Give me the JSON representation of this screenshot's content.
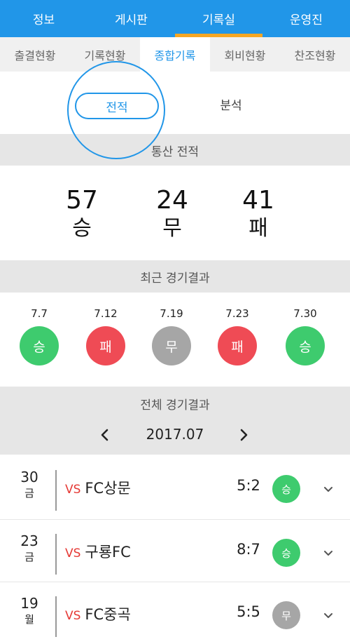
{
  "top_nav": {
    "tabs": [
      "정보",
      "게시판",
      "기록실",
      "운영진"
    ],
    "active": 2
  },
  "sub_nav": {
    "tabs": [
      "출결현황",
      "기록현황",
      "종합기록",
      "회비현황",
      "찬조현황"
    ],
    "active": 2
  },
  "segment": {
    "active": "전적",
    "other": "분석"
  },
  "record": {
    "header": "통산 전적",
    "win": {
      "value": "57",
      "label": "승"
    },
    "draw": {
      "value": "24",
      "label": "무"
    },
    "loss": {
      "value": "41",
      "label": "패"
    }
  },
  "recent": {
    "header": "최근 경기결과",
    "items": [
      {
        "date": "7.7",
        "result": "승"
      },
      {
        "date": "7.12",
        "result": "패"
      },
      {
        "date": "7.19",
        "result": "무"
      },
      {
        "date": "7.23",
        "result": "패"
      },
      {
        "date": "7.30",
        "result": "승"
      }
    ]
  },
  "all_results": {
    "header": "전체 경기결과",
    "month": "2017.07",
    "games": [
      {
        "day": "30",
        "weekday": "금",
        "vs": "VS",
        "opponent": "FC상문",
        "score": "5:2",
        "result": "승"
      },
      {
        "day": "23",
        "weekday": "금",
        "vs": "VS",
        "opponent": "구룡FC",
        "score": "8:7",
        "result": "승"
      },
      {
        "day": "19",
        "weekday": "월",
        "vs": "VS",
        "opponent": "FC중곡",
        "score": "5:5",
        "result": "무"
      }
    ]
  },
  "colors": {
    "accent": "#2196e8",
    "win": "#3ecb6e",
    "loss": "#ef4b55",
    "draw": "#a6a6a6",
    "indicator": "#f5a623"
  },
  "icons": {
    "prev": "chevron-left-icon",
    "next": "chevron-right-icon",
    "expand": "chevron-down-icon"
  }
}
